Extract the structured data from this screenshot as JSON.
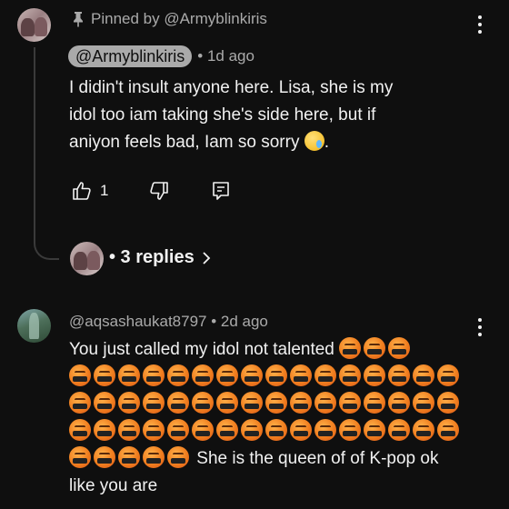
{
  "comment1": {
    "pinned_text": "Pinned by @Armyblinkiris",
    "author": "@Armyblinkiris",
    "time": "• 1d ago",
    "lines": [
      "I didin't insult anyone here.  Lisa,  she is my",
      "idol too iam taking  she's side here,  but if",
      "aniyon feels bad,  Iam so sorry"
    ],
    "line3_end": ".",
    "likes": "1",
    "replies_label": "• 3 replies"
  },
  "comment2": {
    "author_meta": "@aqsashaukat8797 • 2d ago",
    "line1": "You just called my idol not talented",
    "tail1": "She is the queen of of K-pop ok",
    "tail2": "like you are"
  },
  "icons": {
    "pin": "pin-icon",
    "like": "thumb-up-icon",
    "dislike": "thumb-down-icon",
    "reply": "reply-icon",
    "more": "more-vert-icon",
    "chevron": "chevron-right-icon",
    "emoji_cry": "crying-face-emoji",
    "emoji_censored": "face-with-symbols-on-mouth-emoji"
  },
  "colors": {
    "background": "#0f0f0f",
    "text_primary": "#f1f1f1",
    "text_secondary": "#aaaaaa",
    "chip_bg": "#aaaaaa"
  }
}
